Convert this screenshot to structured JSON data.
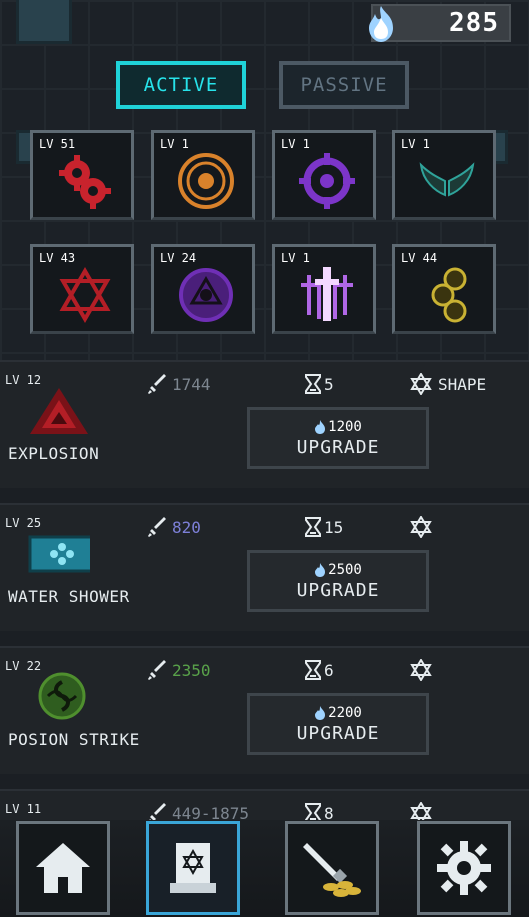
{
  "currency": {
    "amount": "285",
    "icon": "blue-flame-icon"
  },
  "tabs": {
    "active": "ACTIVE",
    "passive": "PASSIVE"
  },
  "skills": [
    {
      "level": "LV 51",
      "icon": "red-gears-icon"
    },
    {
      "level": "LV 1",
      "icon": "orange-sigil-icon"
    },
    {
      "level": "LV 1",
      "icon": "purple-crosshair-icon"
    },
    {
      "level": "LV 1",
      "icon": "teal-wings-icon"
    },
    {
      "level": "LV 43",
      "icon": "red-hexagram-icon"
    },
    {
      "level": "LV 24",
      "icon": "purple-eye-icon"
    },
    {
      "level": "LV 1",
      "icon": "glowing-swords-icon"
    },
    {
      "level": "LV 44",
      "icon": "gold-coins-icon"
    }
  ],
  "rows": [
    {
      "level": "LV 12",
      "name": "EXPLOSION",
      "damage": "1744",
      "damage_color": "#7d8690",
      "cooldown": "5",
      "shape": "SHAPE",
      "cost": "1200",
      "upgrade": "UPGRADE",
      "icon": "red-triangle-icon"
    },
    {
      "level": "LV 25",
      "name": "WATER SHOWER",
      "damage": "820",
      "damage_color": "#7d80d8",
      "cooldown": "15",
      "shape": "",
      "cost": "2500",
      "upgrade": "UPGRADE",
      "icon": "water-tile-icon"
    },
    {
      "level": "LV 22",
      "name": "POSION STRIKE",
      "damage": "2350",
      "damage_color": "#59a24a",
      "cooldown": "6",
      "shape": "",
      "cost": "2200",
      "upgrade": "UPGRADE",
      "icon": "green-poison-icon"
    },
    {
      "level": "LV 11",
      "name": "",
      "damage": "449-1875",
      "damage_color": "#7d8690",
      "cooldown": "8",
      "shape": "",
      "cost": "",
      "upgrade": "",
      "icon": ""
    }
  ],
  "nav": [
    {
      "icon": "home-icon"
    },
    {
      "icon": "spellbook-icon"
    },
    {
      "icon": "sword-gold-icon"
    },
    {
      "icon": "settings-gear-icon"
    }
  ],
  "colors": {
    "accent": "#1fd2d8",
    "flame": "#9fd3ff",
    "background": "#1b1f24"
  }
}
